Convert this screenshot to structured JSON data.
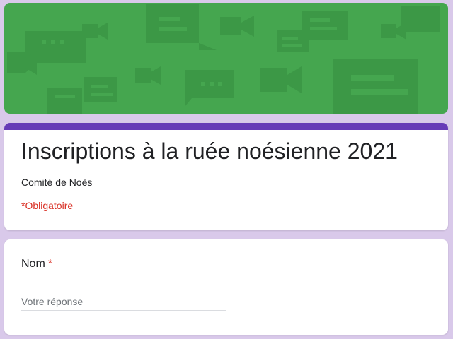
{
  "colors": {
    "page_background": "#d9c9ea",
    "banner_green": "#45a64f",
    "banner_shapes": "#3a9445",
    "accent_purple": "#673ab7",
    "required_red": "#d93025"
  },
  "header": {
    "banner_icons": [
      "chat-bubble-icon",
      "video-camera-icon"
    ]
  },
  "form": {
    "title": "Inscriptions à la ruée noésienne 2021",
    "description": "Comité de Noès",
    "required_note": "*Obligatoire"
  },
  "questions": [
    {
      "label": "Nom",
      "required_marker": "*",
      "value": "",
      "placeholder": "Votre réponse"
    }
  ]
}
